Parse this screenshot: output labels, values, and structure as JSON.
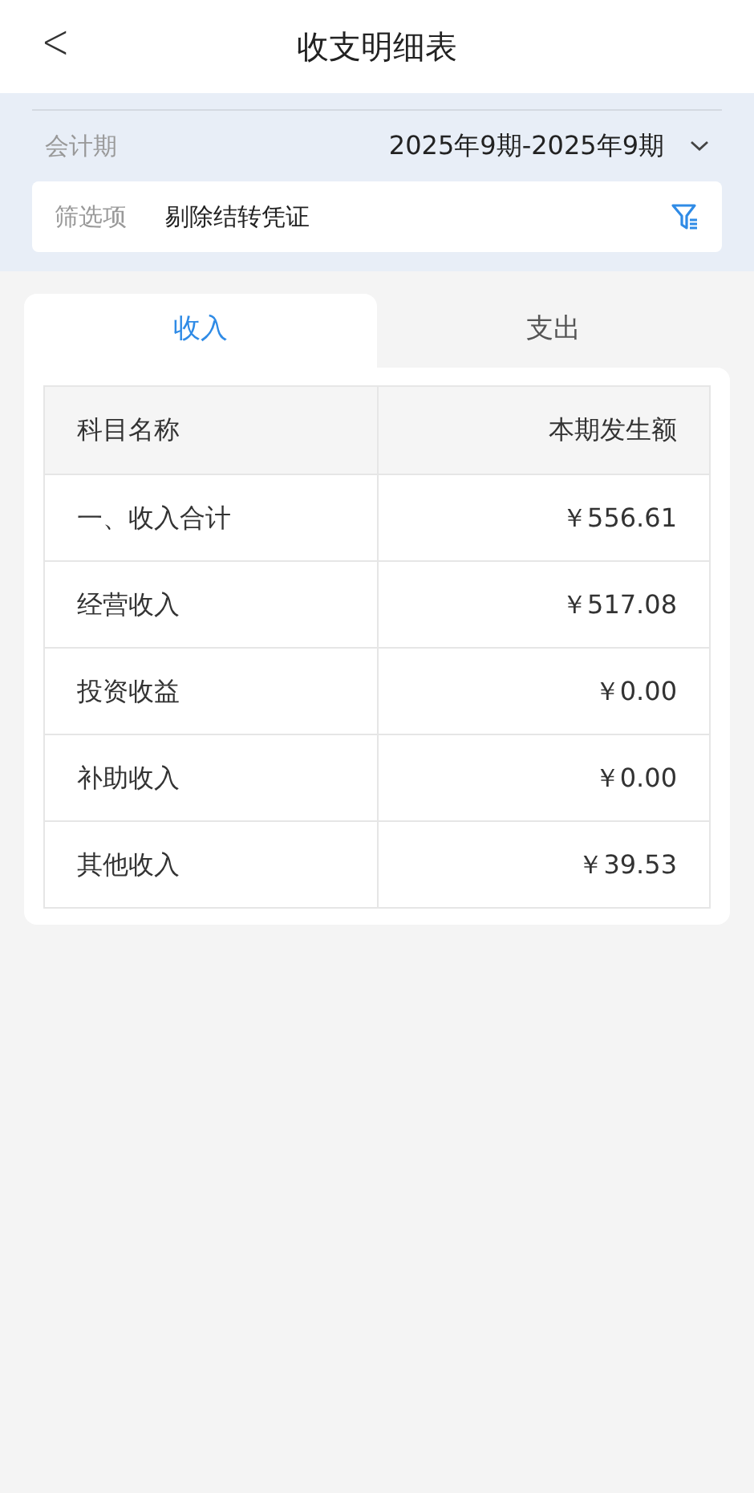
{
  "header": {
    "back_icon": "<",
    "title": "收支明细表"
  },
  "period": {
    "label": "会计期",
    "value": "2025年9期-2025年9期"
  },
  "filter": {
    "label": "筛选项",
    "value": "剔除结转凭证"
  },
  "tabs": [
    {
      "label": "收入",
      "selected": true
    },
    {
      "label": "支出",
      "selected": false
    }
  ],
  "table": {
    "columns": [
      "科目名称",
      "本期发生额"
    ],
    "rows": [
      [
        "一、收入合计",
        "￥556.61"
      ],
      [
        "经营收入",
        "￥517.08"
      ],
      [
        "投资收益",
        "￥0.00"
      ],
      [
        "补助收入",
        "￥0.00"
      ],
      [
        "其他收入",
        "￥39.53"
      ]
    ]
  }
}
